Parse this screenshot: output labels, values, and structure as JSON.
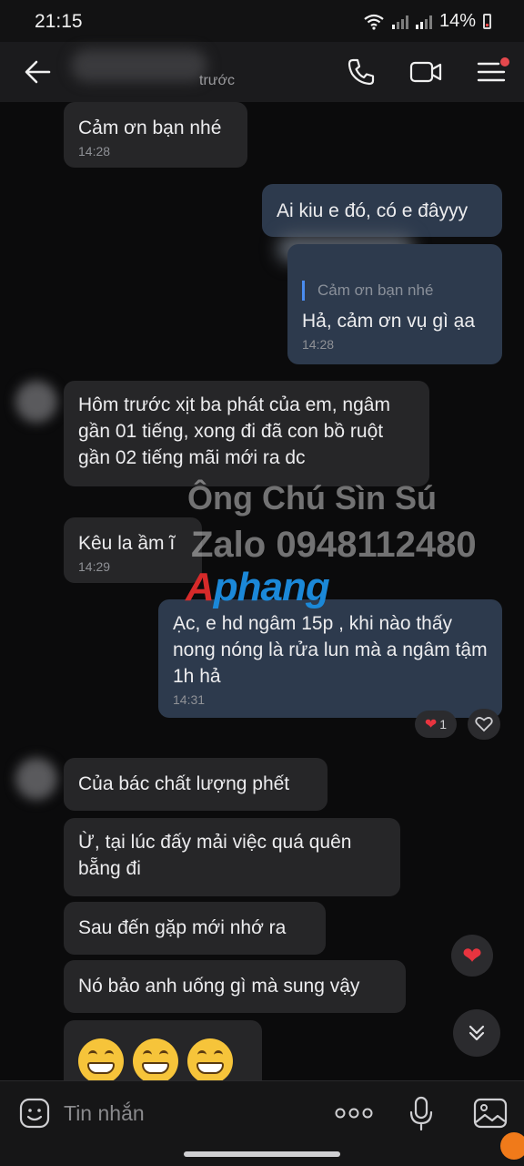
{
  "status_bar": {
    "time": "21:15",
    "battery": "14%"
  },
  "header": {
    "subtitle": "trước"
  },
  "messages": [
    {
      "text": "Cảm ơn bạn nhé",
      "time": "14:28"
    },
    {
      "text": "Ai kiu e đó, có e đâyyy"
    },
    {
      "quote": "Cảm ơn bạn nhé",
      "text": "Hả, cảm ơn vụ gì ạa",
      "time": "14:28"
    },
    {
      "text": "Hôm trước xịt ba phát của em, ngâm gần 01 tiếng, xong đi đã con bồ ruột gần 02 tiếng mãi mới ra dc"
    },
    {
      "text": "Kêu la ầm ĩ",
      "time": "14:29"
    },
    {
      "text": "Ạc, e hd ngâm 15p , khi nào thấy nong nóng là rửa lun mà a ngâm tậm 1h hả",
      "time": "14:31",
      "reaction_count": "1"
    },
    {
      "text": "Của bác chất lượng phết"
    },
    {
      "text": "Ừ, tại lúc đấy mải việc quá quên bẵng đi"
    },
    {
      "text": "Sau đến gặp mới nhớ ra"
    },
    {
      "text": "Nó bảo anh uống gì mà sung vậy"
    }
  ],
  "watermark": {
    "line1": "Ông Chú Sìn Sú",
    "line2": "Zalo 0948112480",
    "logo_a": "A",
    "logo_b": "phang"
  },
  "input": {
    "placeholder": "Tin nhắn"
  },
  "colors": {
    "accent": "#4a8cf0",
    "out_bubble": "#2d3a4d",
    "in_bubble": "#262628"
  }
}
